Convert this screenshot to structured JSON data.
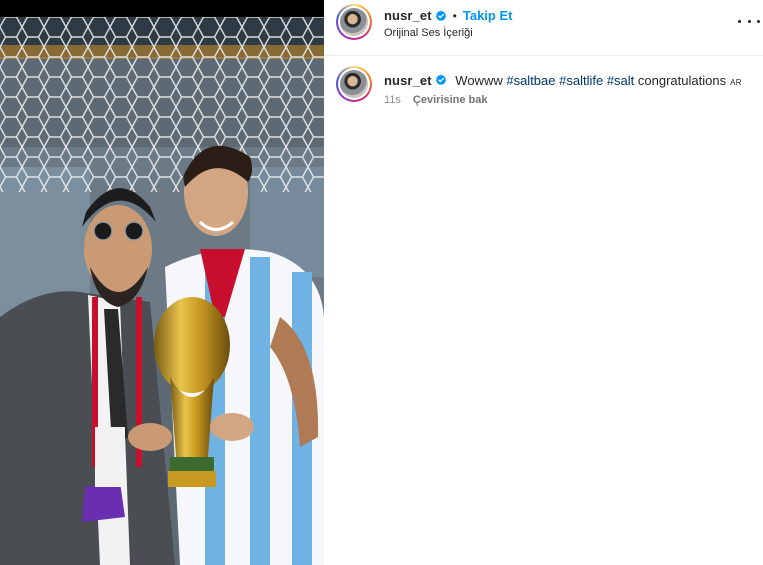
{
  "post": {
    "username": "nusr_et",
    "follow_label": "Takip Et",
    "separator": "•",
    "audio_label": "Orijinal Ses İçeriği",
    "verified": true
  },
  "caption": {
    "username": "nusr_et",
    "text_prefix": "Wowww ",
    "tags": [
      "#saltbae",
      "#saltlife",
      "#salt"
    ],
    "text_suffix": " congratulations",
    "lang_badge": "AR",
    "time": "11s",
    "translate_label": "Çevirisine bak"
  },
  "icons": {
    "verified": "verified-badge-icon",
    "more": "more-options-icon"
  },
  "colors": {
    "accent": "#0095f6",
    "verified": "#0095f6",
    "hashtag": "#00376b",
    "meta": "#8e8e8e"
  }
}
